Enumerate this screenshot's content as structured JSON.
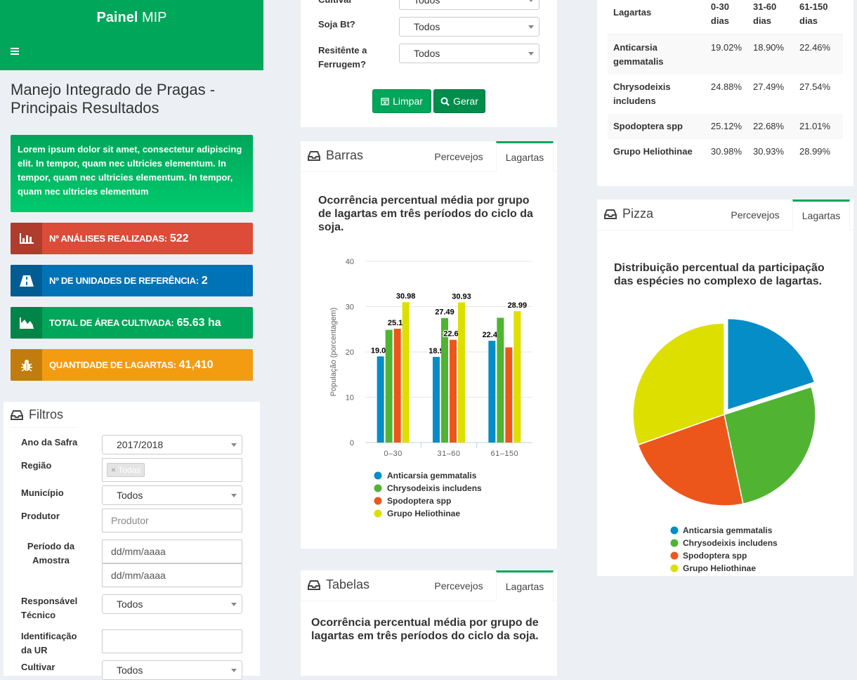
{
  "brand": {
    "bold": "Painel",
    "rest": " MIP"
  },
  "page_title": "Manejo Integrado de Pragas - Principais Resultados",
  "callout": "Lorem ipsum dolor sit amet, consectetur adipiscing elit. In tempor, quam nec ultricies elementum. In tempor, quam nec ultricies elementum. In tempor, quam nec ultricies elementum",
  "info_boxes": [
    {
      "label": "Nº análises realizadas:",
      "value": "522",
      "color": "#dd4b39",
      "icon": "bar-chart-icon"
    },
    {
      "label": "Nº de unidades de referência:",
      "value": "2",
      "color": "#0073b7",
      "icon": "road-icon"
    },
    {
      "label": "Total de área cultivada:",
      "value": "65.63 ha",
      "color": "#00a65a",
      "icon": "area-chart-icon"
    },
    {
      "label": "Quantidade de lagartas:",
      "value": "41,410",
      "color": "#f39c12",
      "icon": "bug-icon"
    }
  ],
  "filtros": {
    "title": "Filtros",
    "ano_label": "Ano da Safra",
    "ano_value": "2017/2018",
    "regiao_label": "Região",
    "regiao_tag": "Todas",
    "municipio_label": "Município",
    "municipio_value": "Todos",
    "produtor_label": "Produtor",
    "produtor_placeholder": "Produtor",
    "periodo_label": "Período da Amostra",
    "date_placeholder": "dd/mm/aaaa",
    "responsavel_label": "Responsável Técnico",
    "responsavel_value": "Todos",
    "identificacao_label": "Identificação da UR",
    "cultivar_label": "Cultivar",
    "cultivar_value": "Todos"
  },
  "top_filters": {
    "cultivar_label": "Cultivar",
    "cultivar_value": "Todos",
    "soja_label": "Soja Bt?",
    "soja_value": "Todos",
    "ferrugem_label": "Resitênte a Ferrugem?",
    "ferrugem_value": "Todos",
    "limpar": "Limpar",
    "gerar": "Gerar"
  },
  "barras": {
    "title": "Barras",
    "tab1": "Percevejos",
    "tab2": "Lagartas",
    "chart_title": "Ocorrência percentual média por grupo de lagartas em três períodos do ciclo da soja."
  },
  "tabelas": {
    "title": "Tabelas",
    "tab1": "Percevejos",
    "tab2": "Lagartas",
    "chart_title": "Ocorrência percentual média por grupo de lagartas em três períodos do ciclo da soja."
  },
  "pizza": {
    "title": "Pizza",
    "tab1": "Percevejos",
    "tab2": "Lagartas",
    "chart_title": "Distribuição percentual da participação das espécies no complexo de lagartas."
  },
  "table": {
    "headers": [
      "Lagartas",
      "0-30 dias",
      "31-60 dias",
      "61-150 dias"
    ],
    "rows": [
      [
        "Anticarsia gemmatalis",
        "19.02%",
        "18.90%",
        "22.46%"
      ],
      [
        "Chrysodeixis includens",
        "24.88%",
        "27.49%",
        "27.54%"
      ],
      [
        "Spodoptera spp",
        "25.12%",
        "22.68%",
        "21.01%"
      ],
      [
        "Grupo Heliothinae",
        "30.98%",
        "30.93%",
        "28.99%"
      ]
    ]
  },
  "chart_data": [
    {
      "type": "bar",
      "categories": [
        "0-30",
        "31-60",
        "61-150"
      ],
      "ylabel": "População (porcentagem)",
      "ylim": [
        0,
        40
      ],
      "yticks": [
        0,
        10,
        20,
        30,
        40
      ],
      "grid": true,
      "series": [
        {
          "name": "Anticarsia gemmatalis",
          "values": [
            19.02,
            18.9,
            22.46
          ],
          "color": "#058dc7"
        },
        {
          "name": "Chrysodeixis includens",
          "values": [
            24.88,
            27.49,
            27.54
          ],
          "color": "#50b432"
        },
        {
          "name": "Spodoptera spp",
          "values": [
            25.12,
            22.68,
            21.01
          ],
          "color": "#ed561b"
        },
        {
          "name": "Grupo Heliothinae",
          "values": [
            30.98,
            30.93,
            28.99
          ],
          "color": "#dddf00"
        }
      ],
      "data_labels": [
        [
          19.02,
          18.9,
          22.46
        ],
        [
          null,
          27.49,
          null
        ],
        [
          25.12,
          22.68,
          null
        ],
        [
          30.98,
          30.93,
          28.99
        ]
      ],
      "legend": "bottom"
    },
    {
      "type": "pie",
      "labels": [
        "Anticarsia gemmatalis",
        "Chrysodeixis includens",
        "Spodoptera spp",
        "Grupo Heliothinae"
      ],
      "values": [
        20.1,
        26.6,
        22.9,
        30.4
      ],
      "colors": [
        "#058dc7",
        "#50b432",
        "#ed561b",
        "#dddf00"
      ],
      "legend": "bottom"
    }
  ]
}
